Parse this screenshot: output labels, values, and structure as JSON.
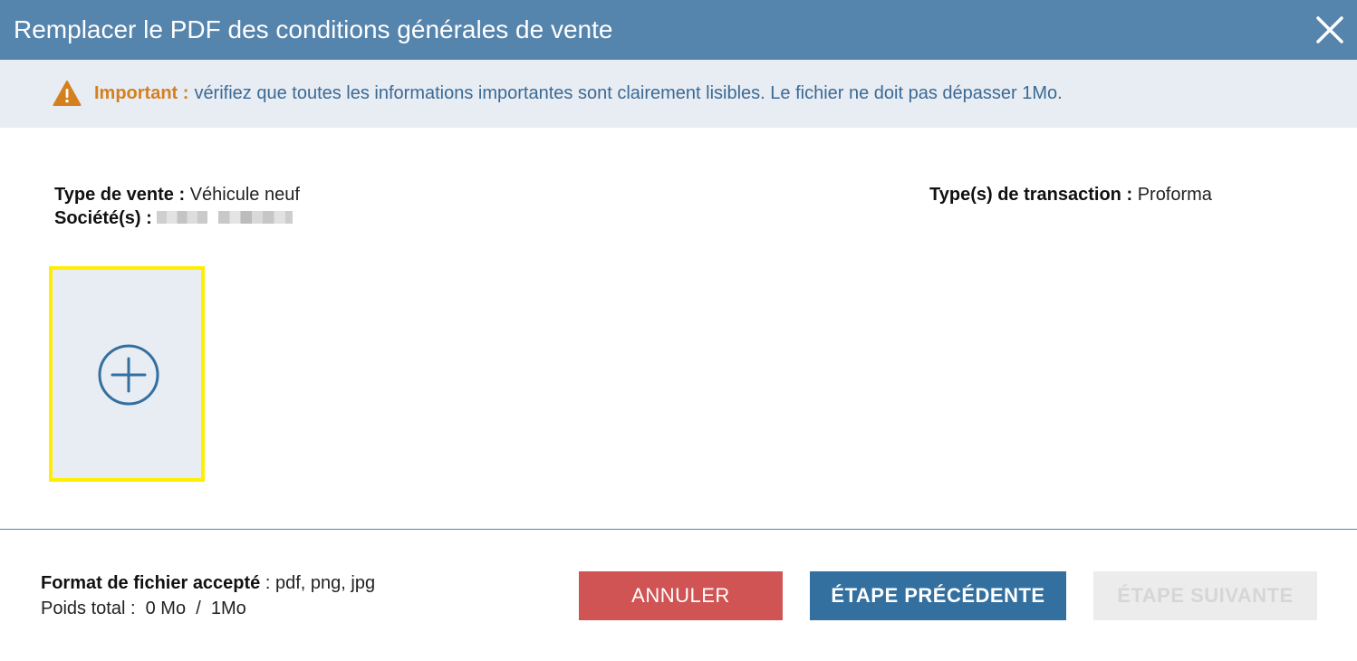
{
  "header": {
    "title": "Remplacer le PDF des conditions générales de vente",
    "close_icon": "close-icon"
  },
  "alert": {
    "icon": "warning-icon",
    "label": "Important :",
    "message": "vérifiez que toutes les informations importantes sont clairement lisibles. Le fichier ne doit pas dépasser 1Mo."
  },
  "info": {
    "sale_type_label": "Type de vente :",
    "sale_type_value": "Véhicule neuf",
    "company_label": "Société(s) :",
    "transaction_label": "Type(s) de transaction :",
    "transaction_value": "Proforma"
  },
  "upload": {
    "icon": "plus-circle-icon"
  },
  "footer": {
    "format_label": "Format de fichier accepté",
    "format_value": " : pdf, png, jpg",
    "weight_text": "Poids total :  0 Mo  /  1Mo",
    "cancel_label": "ANNULER",
    "prev_label": "ÉTAPE PRÉCÉDENTE",
    "next_label": "ÉTAPE SUIVANTE"
  },
  "colors": {
    "header_bg": "#5584ad",
    "alert_bg": "#e8ecf3",
    "alert_accent": "#d4801f",
    "alert_text": "#3a6a95",
    "cancel_bg": "#d05454",
    "primary_bg": "#33709f",
    "disabled_bg": "#ececec",
    "highlight_border": "#ffee00"
  }
}
